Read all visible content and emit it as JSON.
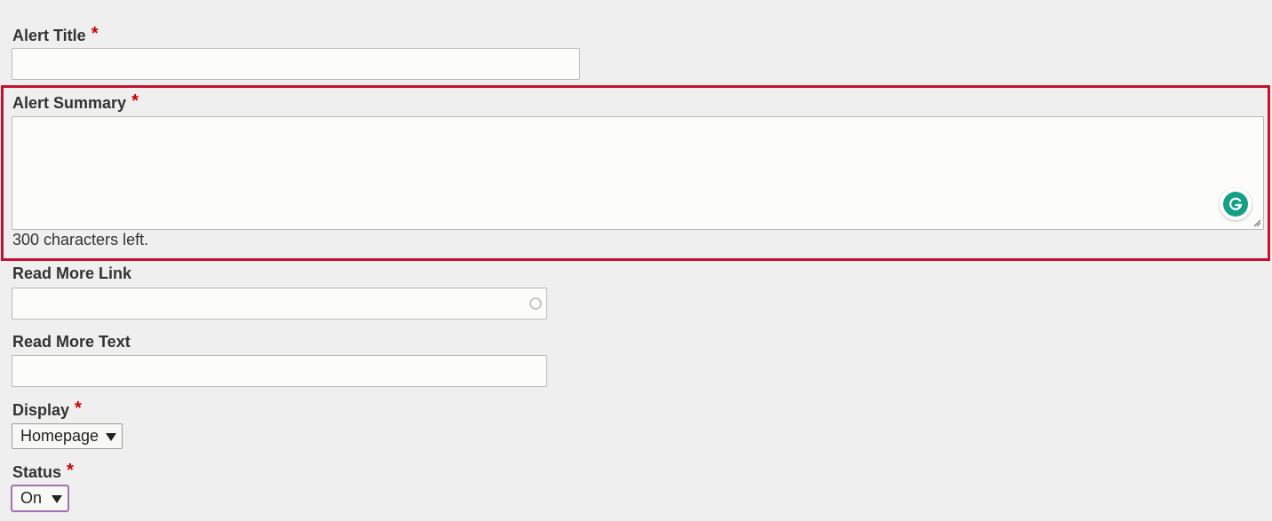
{
  "form": {
    "alert_title": {
      "label": "Alert Title",
      "required_mark": "*",
      "value": ""
    },
    "alert_summary": {
      "label": "Alert Summary",
      "required_mark": "*",
      "value": "",
      "counter": "300 characters left.",
      "highlight_color": "#c4112f"
    },
    "read_more_link": {
      "label": "Read More Link",
      "value": ""
    },
    "read_more_text": {
      "label": "Read More Text",
      "value": ""
    },
    "display": {
      "label": "Display",
      "required_mark": "*",
      "selected": "Homepage"
    },
    "status": {
      "label": "Status",
      "required_mark": "*",
      "selected": "On"
    }
  },
  "icons": {
    "grammarly": "grammarly-icon",
    "resize": "resize-handle-icon",
    "link_status": "link-status-icon",
    "dropdown": "chevron-down-icon"
  },
  "colors": {
    "required": "#cc0000",
    "grammarly": "#15a085",
    "focus": "#a56fb8"
  }
}
